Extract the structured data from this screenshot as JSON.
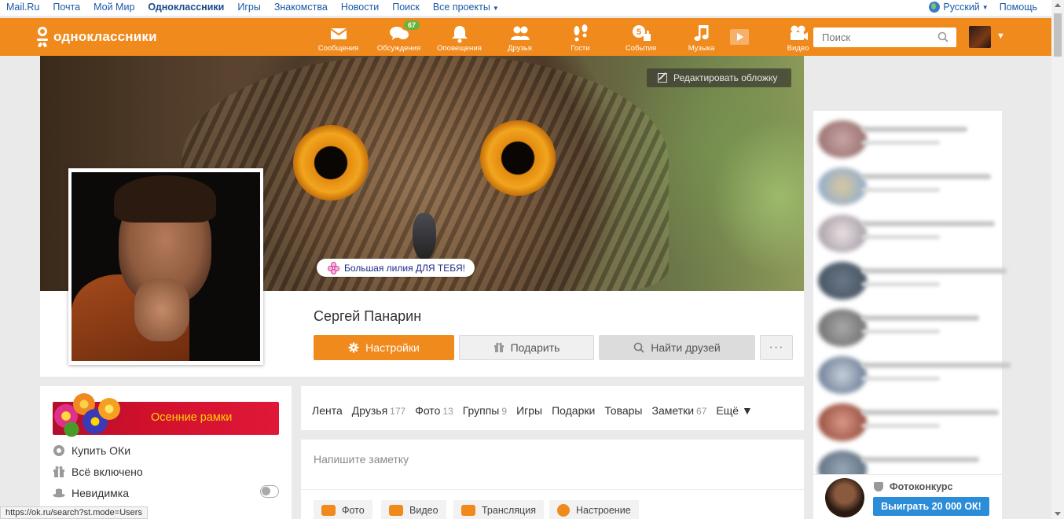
{
  "topbar": {
    "links": [
      "Mail.Ru",
      "Почта",
      "Мой Мир",
      "Одноклассники",
      "Игры",
      "Знакомства",
      "Новости",
      "Поиск",
      "Все проекты"
    ],
    "active_index": 3,
    "language": "Русский",
    "help": "Помощь"
  },
  "header": {
    "logo": "одноклассники",
    "nav": [
      {
        "label": "Сообщения",
        "icon": "envelope-icon"
      },
      {
        "label": "Обсуждения",
        "icon": "chat-bubbles-icon",
        "badge": "67"
      },
      {
        "label": "Оповещения",
        "icon": "bell-icon"
      },
      {
        "label": "Друзья",
        "icon": "people-icon"
      },
      {
        "label": "Гости",
        "icon": "footprints-icon"
      },
      {
        "label": "События",
        "icon": "events-icon",
        "badge_inline": "5"
      },
      {
        "label": "Музыка",
        "icon": "music-note-icon"
      },
      {
        "label": "Видео",
        "icon": "video-camera-icon"
      }
    ],
    "search_placeholder": "Поиск"
  },
  "cover": {
    "edit_label": "Редактировать обложку",
    "gift_text": "Большая лилия ДЛЯ ТЕБЯ!"
  },
  "profile": {
    "name": "Сергей Панарин",
    "buttons": {
      "settings": "Настройки",
      "gift": "Подарить",
      "find_friends": "Найти друзей",
      "more": "···"
    }
  },
  "left": {
    "banner": "Осенние рамки",
    "menu": [
      "Купить ОКи",
      "Всё включено",
      "Невидимка"
    ]
  },
  "tabs": [
    {
      "label": "Лента"
    },
    {
      "label": "Друзья",
      "count": "177"
    },
    {
      "label": "Фото",
      "count": "13"
    },
    {
      "label": "Группы",
      "count": "9"
    },
    {
      "label": "Игры"
    },
    {
      "label": "Подарки"
    },
    {
      "label": "Товары"
    },
    {
      "label": "Заметки",
      "count": "67"
    },
    {
      "label": "Ещё ▼"
    }
  ],
  "note": {
    "placeholder": "Напишите заметку",
    "buttons": [
      "Фото",
      "Видео",
      "Трансляция",
      "Настроение"
    ]
  },
  "contest": {
    "title": "Фотоконкурс",
    "button": "Выиграть 20 000 ОК!"
  },
  "status_url": "https://ok.ru/search?st.mode=Users",
  "colors": {
    "brand_orange": "#f18a1c",
    "badge_green": "#6ab23a",
    "link_blue": "#1a5aa6",
    "contest_blue": "#2b8cd8",
    "banner_red": "#d0102c",
    "banner_text": "#ffd200"
  }
}
